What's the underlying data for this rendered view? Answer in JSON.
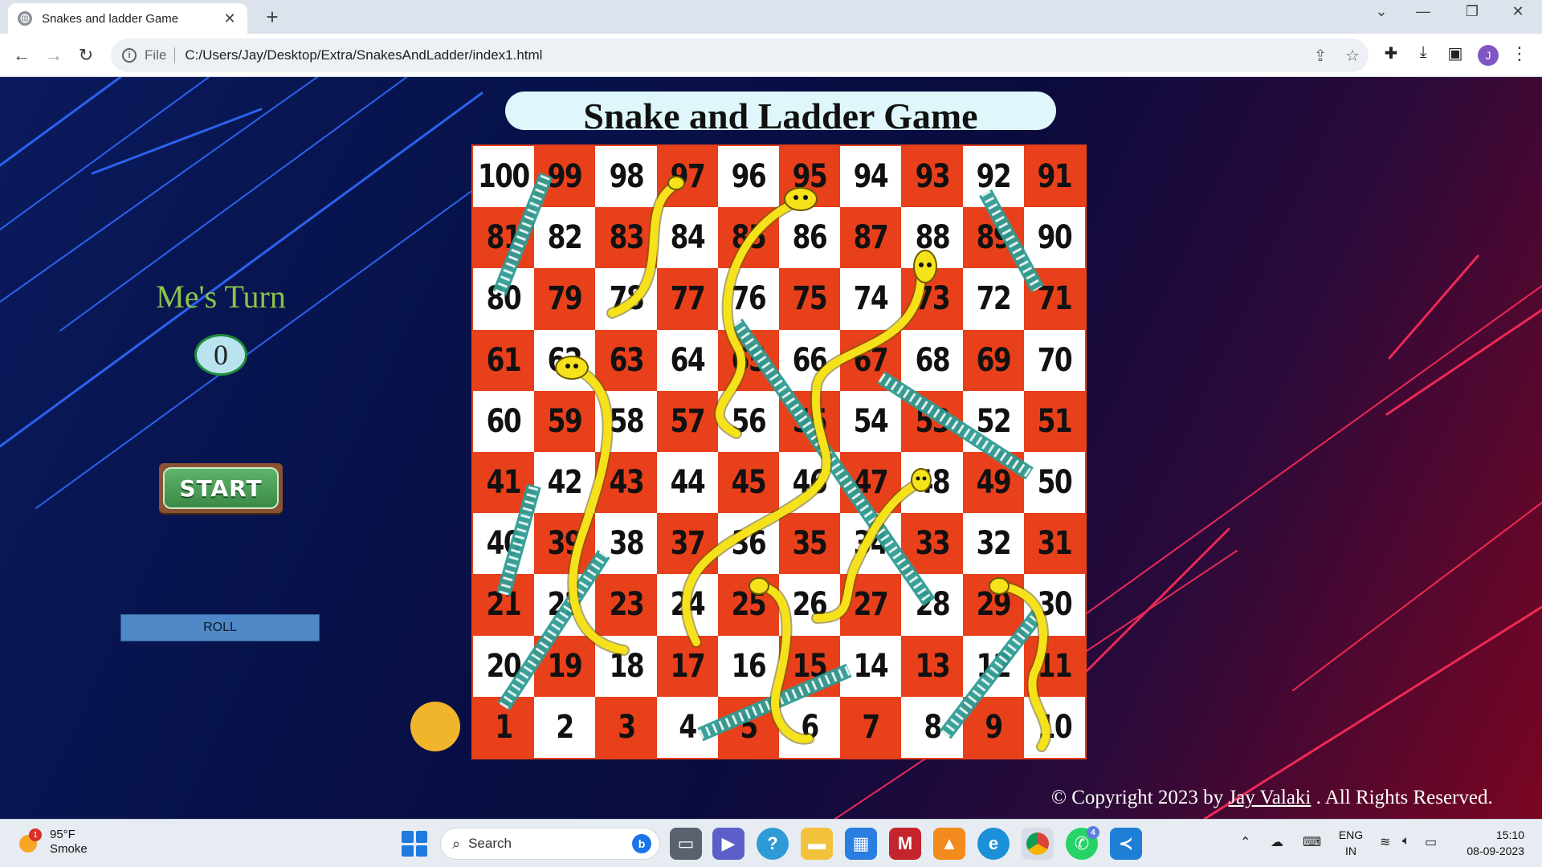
{
  "browser": {
    "tab_title": "Snakes and ladder Game",
    "close_label": "✕",
    "new_tab_label": "+",
    "omnibox_scheme": "File",
    "url": "C:/Users/Jay/Desktop/Extra/SnakesAndLadder/index1.html",
    "profile_initial": "J"
  },
  "page": {
    "title": "Snake and Ladder Game",
    "turn_label": "Me's Turn",
    "dice_value": "0",
    "start_label": "START",
    "roll_label": "ROLL",
    "copyright_prefix": "© Copyright 2023 by ",
    "copyright_author": "Jay Valaki",
    "copyright_suffix": " . All Rights Reserved."
  },
  "board": {
    "rows": [
      [
        100,
        99,
        98,
        97,
        96,
        95,
        94,
        93,
        92,
        91
      ],
      [
        81,
        82,
        83,
        84,
        85,
        86,
        87,
        88,
        89,
        90
      ],
      [
        80,
        79,
        78,
        77,
        76,
        75,
        74,
        73,
        72,
        71
      ],
      [
        61,
        62,
        63,
        64,
        65,
        66,
        67,
        68,
        69,
        70
      ],
      [
        60,
        59,
        58,
        57,
        56,
        55,
        54,
        53,
        52,
        51
      ],
      [
        41,
        42,
        43,
        44,
        45,
        46,
        47,
        48,
        49,
        50
      ],
      [
        40,
        39,
        38,
        37,
        36,
        35,
        34,
        33,
        32,
        31
      ],
      [
        21,
        22,
        23,
        24,
        25,
        26,
        27,
        28,
        29,
        30
      ],
      [
        20,
        19,
        18,
        17,
        16,
        15,
        14,
        13,
        12,
        11
      ],
      [
        1,
        2,
        3,
        4,
        5,
        6,
        7,
        8,
        9,
        10
      ]
    ],
    "red_color": "#e8401b",
    "white_color": "#ffffff",
    "snake_color": "#f5e21a",
    "ladder_color": "#2f9c93"
  },
  "taskbar": {
    "weather_temp": "95°F",
    "weather_desc": "Smoke",
    "weather_badge": "1",
    "search_placeholder": "Search",
    "whatsapp_badge": "4",
    "lang_top": "ENG",
    "lang_bottom": "IN",
    "time": "15:10",
    "date": "08-09-2023"
  }
}
